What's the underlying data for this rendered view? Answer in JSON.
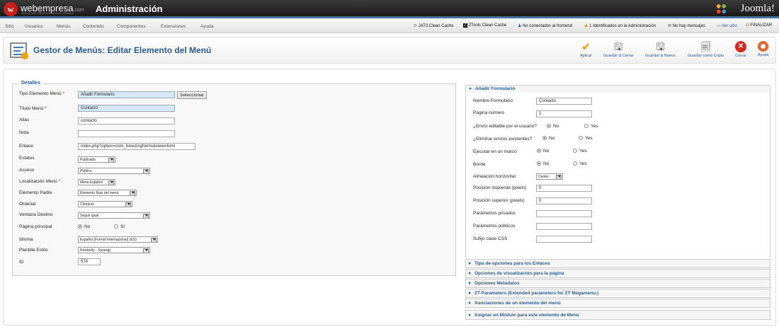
{
  "header": {
    "brand": "webempresa",
    "brand_suffix": ".com",
    "brand_tagline": "SERVICIOS PROFESIONALES JOOMLA",
    "logo_glyph": "w",
    "app_title": "Administración",
    "joomla_label": "Joomla!"
  },
  "menu": [
    "Sitio",
    "Usuarios",
    "Menús",
    "Contenido",
    "Componentes",
    "Extensiones",
    "Ayuda"
  ],
  "status": {
    "jat3": "JAT3 Clean Cache",
    "ztools": "ZTools Clean Cache",
    "frontend": "No conectados al frontend",
    "admin": "1 Identificados en la Administración",
    "messages": "No hay mensajes",
    "site": "Ver sitio",
    "logout": "FINALIZAR"
  },
  "toolbar": {
    "title": "Gestor de Menús: Editar Elemento del Menú",
    "apply": "Aplicar",
    "save_close": "Guardar & Cerrar",
    "save_new": "Guardar & Nuevo",
    "save_copy": "Guardar como Copia",
    "close": "Cerrar",
    "help": "Ayuda"
  },
  "details": {
    "legend": "Detalles",
    "labels": {
      "type": "Tipo Elemento Menú",
      "title": "Título Menú",
      "alias": "Alias",
      "note": "Nota",
      "link": "Enlace",
      "status": "Estatus",
      "access": "Acceso",
      "location": "Localización Menú",
      "parent": "Elemento Padre",
      "order": "Ordenar",
      "target": "Ventana Destino",
      "home": "Página principal",
      "language": "Idioma",
      "template": "Plantilla Estilo",
      "id": "ID"
    },
    "values": {
      "type": "Añadir Formulario",
      "select_button": "Seleccionar",
      "title": "Contacto",
      "alias": "contacto",
      "note": "",
      "link": "index.php?option=com_breezingforms&view=form",
      "status": "Publicado",
      "access": "Público",
      "location": "Menú Español",
      "parent": "Elemento Raiz del menú",
      "order": "Contacto",
      "target": "Seguir igual",
      "home_no": "No",
      "home_yes": "Sí",
      "language": "Español (Formal Internacional) (ES)",
      "template": "Nicebody - Synergy",
      "id": "574"
    }
  },
  "form_panel": {
    "title": "Añadir Formulario",
    "labels": {
      "form_name": "Nombre Formulario",
      "page_number": "Página número",
      "editable": "¿Envío editable por el usuario?",
      "delete": "¿Eliminar envíos existentes?",
      "frame": "Ejecutar en un marco",
      "border": "Borde",
      "align": "Alineación horizontal",
      "left": "Posición izquierda (pixels)",
      "top": "Posición superior (pixels)",
      "private": "Parámetros privados",
      "public": "Parámetros públicos",
      "suffix": "Sufijo clase CSS"
    },
    "values": {
      "form_name": "Contacto",
      "page_number": "1",
      "align": "Center",
      "left": "0",
      "top": "0",
      "private": "",
      "public": "",
      "suffix": "",
      "no": "No",
      "yes": "Yes"
    }
  },
  "collapsed_panels": [
    "Tipo de opciones para los Enlaces",
    "Opciones de visualización para la página",
    "Opciones Metadatos",
    "ZT Parameters (Extended parameters for ZT Megamenu.)",
    "Asociaciones de un elemento del menú",
    "Asignar un Módulo para este elemento de Menú"
  ],
  "colors": {
    "topbar": "#2a2a2a",
    "accent": "#2c5c8e",
    "brand_red": "#c8201d",
    "apply_orange": "#f2a20b",
    "close_red": "#d9271b",
    "input_blue": "#d9e8f6"
  }
}
